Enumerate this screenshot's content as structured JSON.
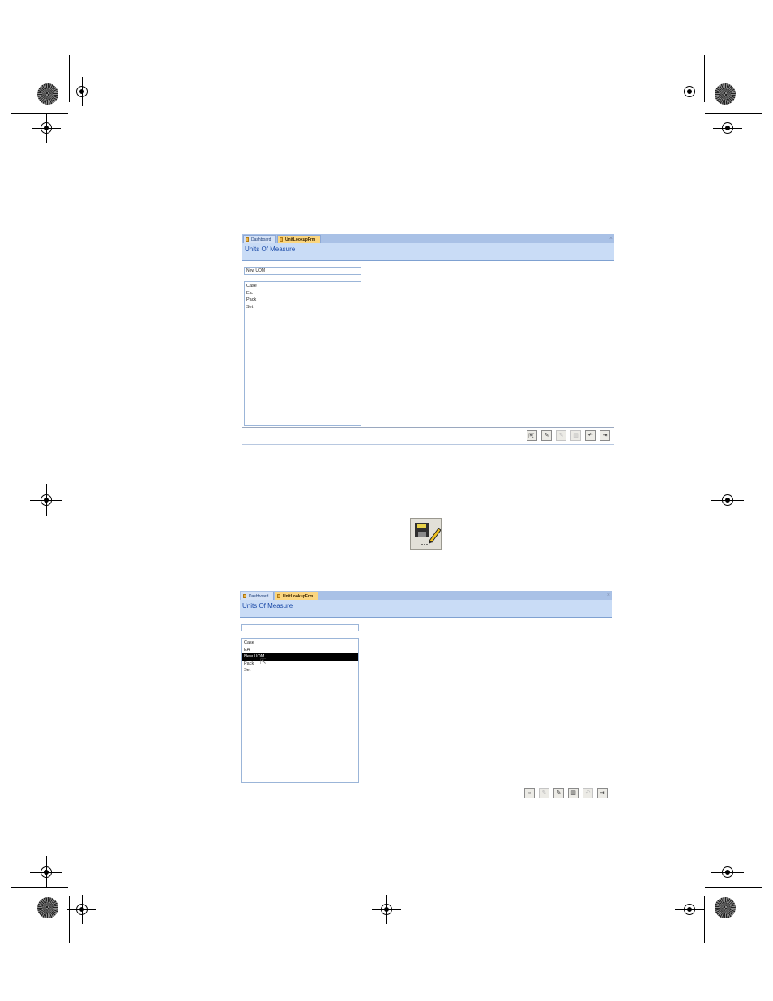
{
  "screenshot_1": {
    "tabs": [
      {
        "label": "Dashboard",
        "active": false
      },
      {
        "label": "UnitLookupFrm",
        "active": true
      }
    ],
    "close_glyph": "×",
    "header_title": "Units Of Measure",
    "input_value": "New UOM",
    "list_items": [
      "Case",
      "Ea.",
      "Pack",
      "Set"
    ],
    "toolbar": [
      {
        "icon": "new-record-icon",
        "glyph": "▫",
        "enabled": true
      },
      {
        "icon": "save-edit-icon",
        "glyph": "✎",
        "enabled": true
      },
      {
        "icon": "edit-record-icon",
        "glyph": "✎",
        "enabled": false
      },
      {
        "icon": "delete-icon",
        "glyph": "▥",
        "enabled": false
      },
      {
        "icon": "undo-icon",
        "glyph": "↶",
        "enabled": true
      },
      {
        "icon": "exit-icon",
        "glyph": "⇥",
        "enabled": true
      }
    ]
  },
  "center_icon": {
    "icon": "save-edit-icon"
  },
  "screenshot_2": {
    "tabs": [
      {
        "label": "Dashboard",
        "active": false
      },
      {
        "label": "UnitLookupFrm",
        "active": true
      }
    ],
    "close_glyph": "×",
    "header_title": "Units Of Measure",
    "input_value": "",
    "list_items": [
      "Case",
      "EA",
      "New UOM",
      "Pack",
      "Set"
    ],
    "selected_item": "New UOM",
    "toolbar": [
      {
        "icon": "new-record-icon",
        "glyph": "▫",
        "enabled": true
      },
      {
        "icon": "save-edit-icon",
        "glyph": "✎",
        "enabled": false
      },
      {
        "icon": "edit-record-icon",
        "glyph": "✎",
        "enabled": true
      },
      {
        "icon": "delete-icon",
        "glyph": "▥",
        "enabled": true
      },
      {
        "icon": "undo-icon",
        "glyph": "↶",
        "enabled": false
      },
      {
        "icon": "exit-icon",
        "glyph": "⇥",
        "enabled": true
      }
    ]
  },
  "colors": {
    "tab_bar": "#a9c1e6",
    "header": "#c9dcf6",
    "active_tab": "#fbd67f",
    "title_text": "#1c4ba8",
    "selection": "#000000"
  }
}
